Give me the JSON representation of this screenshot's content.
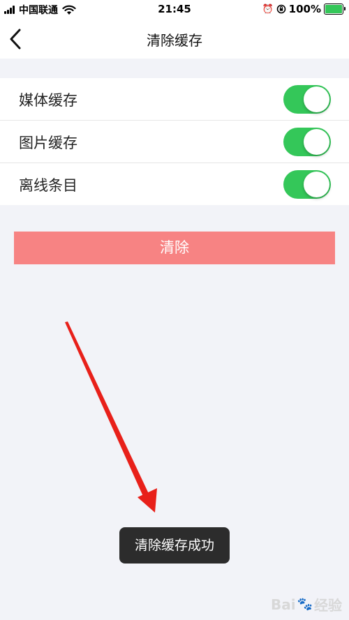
{
  "status_bar": {
    "carrier": "中国联通",
    "time": "21:45",
    "battery_percent": "100%",
    "icons": [
      "signal-icon",
      "wifi-icon",
      "alarm-icon",
      "orientation-lock-icon",
      "battery-icon"
    ]
  },
  "nav": {
    "title": "清除缓存",
    "back_icon": "chevron-left-icon"
  },
  "settings": {
    "items": [
      {
        "label": "媒体缓存",
        "enabled": true
      },
      {
        "label": "图片缓存",
        "enabled": true
      },
      {
        "label": "离线条目",
        "enabled": true
      }
    ]
  },
  "clear_button": {
    "label": "清除"
  },
  "toast": {
    "message": "清除缓存成功"
  },
  "watermark": {
    "text_left": "Bai",
    "text_right": "经验",
    "icon": "paw-icon"
  },
  "colors": {
    "toggle_on": "#34c759",
    "clear_button": "#f78383",
    "toast_bg": "#2c2c2c",
    "arrow": "#e8201a",
    "background": "#f2f3f8"
  }
}
